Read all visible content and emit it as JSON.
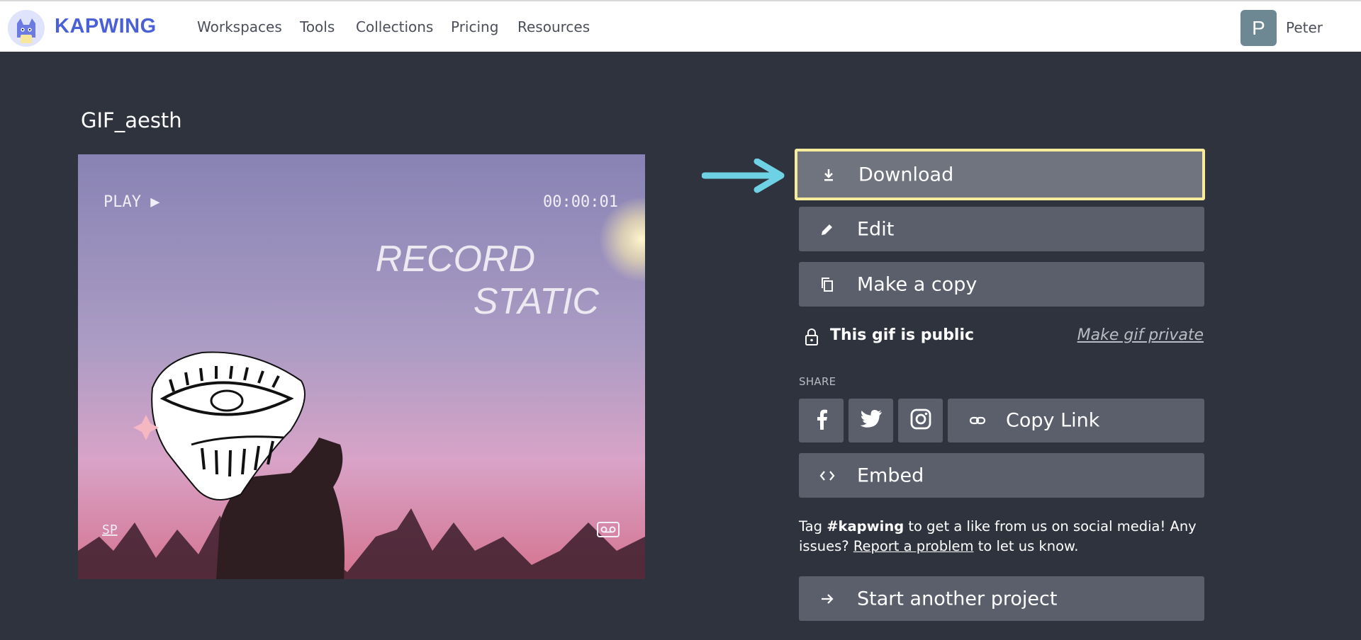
{
  "header": {
    "brand": "KAPWING",
    "nav": [
      "Workspaces",
      "Tools",
      "Collections",
      "Pricing",
      "Resources"
    ],
    "user": {
      "initial": "P",
      "name": "Peter"
    }
  },
  "project": {
    "title": "GIF_aesth",
    "preview": {
      "top_left": "PLAY ▶",
      "timecode": "00:00:01",
      "line1": "RECORD",
      "line2": "STATIC",
      "bottom_left": "SP"
    }
  },
  "actions": {
    "download": "Download",
    "edit": "Edit",
    "copy": "Make a copy",
    "visibility": "This gif is public",
    "make_private": "Make gif private",
    "share_label": "SHARE",
    "copy_link": "Copy Link",
    "embed": "Embed",
    "start_another": "Start another project"
  },
  "info": {
    "part1": "Tag ",
    "hashtag": "#kapwing",
    "part2": " to get a like from us on social media! Any issues? ",
    "report_link": "Report a problem",
    "part3": " to let us know."
  },
  "colors": {
    "background": "#2f333e",
    "button": "#5b5f6b",
    "brand": "#4a60d6",
    "highlight": "#f6ec9b",
    "arrow": "#6ed1e4"
  }
}
